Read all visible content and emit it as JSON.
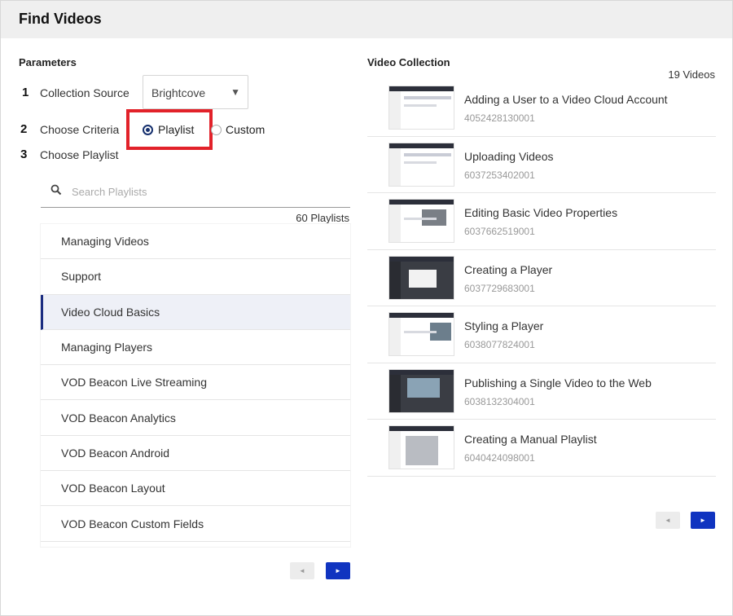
{
  "header": {
    "title": "Find Videos"
  },
  "parameters": {
    "section_title": "Parameters",
    "steps": [
      {
        "num": "1",
        "label": "Collection Source"
      },
      {
        "num": "2",
        "label": "Choose Criteria"
      },
      {
        "num": "3",
        "label": "Choose Playlist"
      }
    ],
    "collection_source": {
      "value": "Brightcove"
    },
    "criteria": {
      "options": [
        {
          "label": "Playlist",
          "selected": true
        },
        {
          "label": "Custom",
          "selected": false
        }
      ]
    },
    "search": {
      "placeholder": "Search Playlists"
    },
    "playlist_count": "60 Playlists",
    "playlists": [
      "Managing Videos",
      "Support",
      "Video Cloud Basics",
      "Managing Players",
      "VOD Beacon Live Streaming",
      "VOD Beacon Analytics",
      "VOD Beacon Android",
      "VOD Beacon Layout",
      "VOD Beacon Custom Fields"
    ],
    "active_playlist": "Video Cloud Basics",
    "pager": {
      "prev": "◄",
      "next": "►"
    }
  },
  "collection": {
    "section_title": "Video Collection",
    "video_count": "19 Videos",
    "videos": [
      {
        "title": "Adding a User to a Video Cloud Account",
        "id": "4052428130001"
      },
      {
        "title": "Uploading Videos",
        "id": "6037253402001"
      },
      {
        "title": "Editing Basic Video Properties",
        "id": "6037662519001"
      },
      {
        "title": "Creating a Player",
        "id": "6037729683001"
      },
      {
        "title": "Styling a Player",
        "id": "6038077824001"
      },
      {
        "title": "Publishing a Single Video to the Web",
        "id": "6038132304001"
      },
      {
        "title": "Creating a Manual Playlist",
        "id": "6040424098001"
      }
    ],
    "pager": {
      "prev": "◄",
      "next": "►"
    }
  },
  "colors": {
    "accent": "#1034c0",
    "highlight": "#e2222a",
    "active_border": "#1b2c80"
  }
}
